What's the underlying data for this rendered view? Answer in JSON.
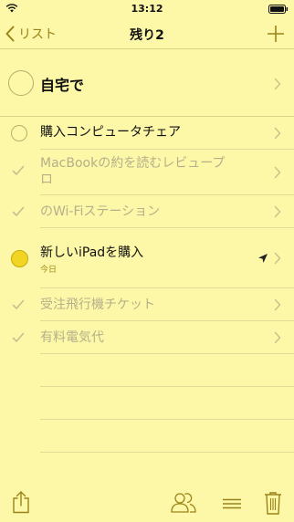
{
  "status_bar": {
    "time": "13:12"
  },
  "nav": {
    "back_label": "リスト",
    "title": "残り2"
  },
  "group": {
    "title": "自宅で"
  },
  "items": [
    {
      "text": "購入コンピュータチェア",
      "state": "active"
    },
    {
      "text": "MacBookの約を読むレビュープ",
      "text2": "ロ",
      "state": "done"
    },
    {
      "text": "のWi-Fiステーション",
      "state": "done"
    },
    {
      "text": "新しいiPadを購入",
      "subtitle": "今日",
      "state": "active-alarm"
    },
    {
      "text": "受注飛行機チケット",
      "state": "done"
    },
    {
      "text": "有料電気代",
      "state": "done"
    }
  ],
  "colors": {
    "background": "#fdf7a8",
    "accent": "#9a8419",
    "done_text": "#b5b08a",
    "alarm_fill": "#f2d423"
  },
  "icons": [
    "wifi-icon",
    "battery-icon",
    "chevron-left-icon",
    "plus-icon",
    "chevron-right-icon",
    "check-icon",
    "location-arrow-icon",
    "share-icon",
    "people-icon",
    "list-icon",
    "trash-icon"
  ]
}
